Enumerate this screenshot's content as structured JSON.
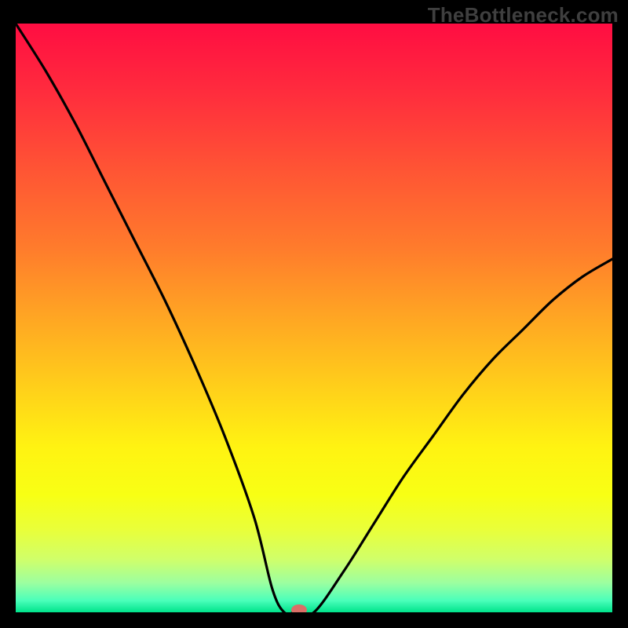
{
  "watermark": "TheBottleneck.com",
  "chart_data": {
    "type": "line",
    "title": "",
    "xlabel": "",
    "ylabel": "",
    "xlim": [
      0,
      1
    ],
    "ylim": [
      0,
      100
    ],
    "background_gradient": {
      "stops": [
        {
          "offset": 0.0,
          "color": "#ff0d42"
        },
        {
          "offset": 0.12,
          "color": "#ff2d3d"
        },
        {
          "offset": 0.25,
          "color": "#ff5534"
        },
        {
          "offset": 0.38,
          "color": "#ff7b2c"
        },
        {
          "offset": 0.5,
          "color": "#ffa623"
        },
        {
          "offset": 0.62,
          "color": "#ffd01a"
        },
        {
          "offset": 0.72,
          "color": "#fff312"
        },
        {
          "offset": 0.8,
          "color": "#f8ff14"
        },
        {
          "offset": 0.86,
          "color": "#e9ff3a"
        },
        {
          "offset": 0.91,
          "color": "#d0ff6a"
        },
        {
          "offset": 0.95,
          "color": "#9cffa0"
        },
        {
          "offset": 0.98,
          "color": "#4bffba"
        },
        {
          "offset": 1.0,
          "color": "#00e38b"
        }
      ]
    },
    "series": [
      {
        "name": "bottleneck-curve",
        "color": "#000000",
        "x": [
          0.0,
          0.05,
          0.1,
          0.15,
          0.2,
          0.25,
          0.3,
          0.35,
          0.4,
          0.43,
          0.45,
          0.47,
          0.5,
          0.55,
          0.6,
          0.65,
          0.7,
          0.75,
          0.8,
          0.85,
          0.9,
          0.95,
          1.0
        ],
        "y": [
          100,
          92,
          83,
          73,
          63,
          53,
          42,
          30,
          16,
          4,
          0,
          0,
          0,
          7,
          15,
          23,
          30,
          37,
          43,
          48,
          53,
          57,
          60
        ]
      }
    ],
    "marker": {
      "name": "min-marker",
      "x": 0.475,
      "y": 0,
      "color": "#db6f67",
      "rx": 10,
      "ry": 7
    }
  }
}
